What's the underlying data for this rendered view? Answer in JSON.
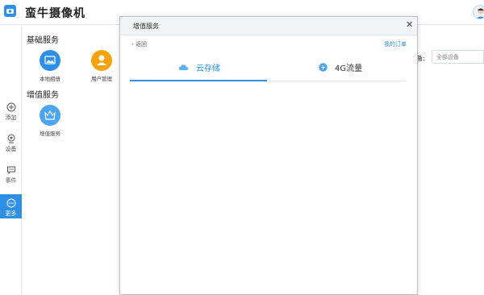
{
  "app": {
    "title": "蛮牛摄像机"
  },
  "rail": {
    "items": [
      {
        "label": "添加",
        "icon": "add-icon"
      },
      {
        "label": "设备",
        "icon": "camera-icon"
      },
      {
        "label": "事件",
        "icon": "message-icon"
      },
      {
        "label": "更多",
        "icon": "more-icon",
        "active": true
      }
    ]
  },
  "main": {
    "sections": [
      {
        "title": "基础服务",
        "tiles": [
          {
            "label": "本地相册",
            "icon": "album-icon",
            "color": "#2e8fe6"
          },
          {
            "label": "用户管理",
            "icon": "user-icon",
            "color": "#f5a30a"
          }
        ]
      },
      {
        "title": "增值服务",
        "tiles": [
          {
            "label": "增值服务",
            "icon": "vip-crown-icon",
            "color": "#4ca5f0"
          }
        ]
      }
    ],
    "filter": {
      "label": "备:",
      "placeholder": "全部设备"
    }
  },
  "modal": {
    "title": "增值服务",
    "back_label": "返回",
    "orders_label": "我的订单",
    "tabs": [
      {
        "label": "云存储",
        "icon": "cloud-icon",
        "active": true
      },
      {
        "label": "4G流量",
        "icon": "signal-4g-icon",
        "active": false
      }
    ]
  },
  "colors": {
    "accent": "#2e8fe6",
    "orange": "#f5a30a",
    "rail_active": "#2e8fe6"
  }
}
